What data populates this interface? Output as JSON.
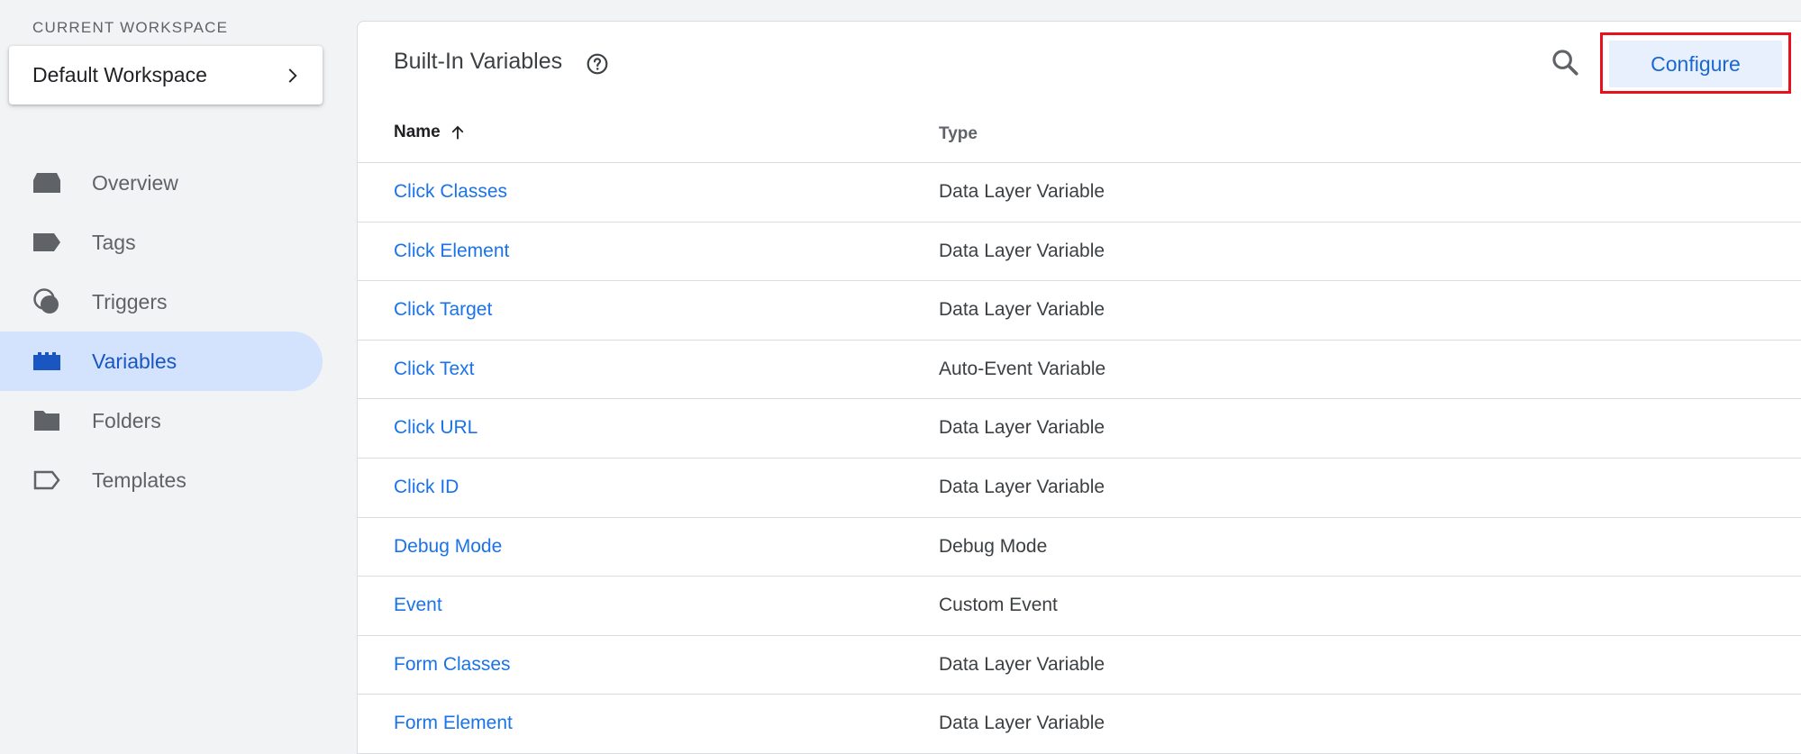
{
  "workspace": {
    "label": "CURRENT WORKSPACE",
    "name": "Default Workspace",
    "chevron_icon": "chevron-right-icon"
  },
  "nav": {
    "items": [
      {
        "label": "Overview",
        "icon": "overview-icon",
        "active": false
      },
      {
        "label": "Tags",
        "icon": "tag-icon",
        "active": false
      },
      {
        "label": "Triggers",
        "icon": "trigger-icon",
        "active": false
      },
      {
        "label": "Variables",
        "icon": "variables-icon",
        "active": true
      },
      {
        "label": "Folders",
        "icon": "folder-icon",
        "active": false
      },
      {
        "label": "Templates",
        "icon": "template-icon",
        "active": false
      }
    ]
  },
  "panel": {
    "title": "Built-In Variables",
    "configure_label": "Configure",
    "columns": {
      "name": "Name",
      "type": "Type"
    },
    "rows": [
      {
        "name": "Click Classes",
        "type": "Data Layer Variable"
      },
      {
        "name": "Click Element",
        "type": "Data Layer Variable"
      },
      {
        "name": "Click Target",
        "type": "Data Layer Variable"
      },
      {
        "name": "Click Text",
        "type": "Auto-Event Variable"
      },
      {
        "name": "Click URL",
        "type": "Data Layer Variable"
      },
      {
        "name": "Click ID",
        "type": "Data Layer Variable"
      },
      {
        "name": "Debug Mode",
        "type": "Debug Mode"
      },
      {
        "name": "Event",
        "type": "Custom Event"
      },
      {
        "name": "Form Classes",
        "type": "Data Layer Variable"
      },
      {
        "name": "Form Element",
        "type": "Data Layer Variable"
      }
    ]
  },
  "colors": {
    "accent": "#1a73e8",
    "active_nav_bg": "#d3e3fd",
    "highlight_border": "#e8101d",
    "configure_bg": "#e8f0fe"
  }
}
